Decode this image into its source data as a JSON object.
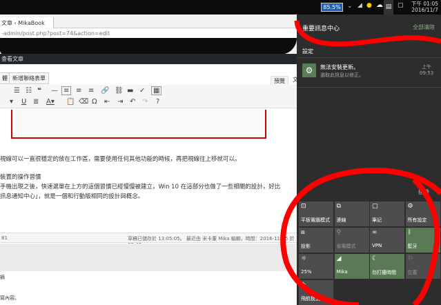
{
  "taskbar": {
    "battery": "85.5%",
    "time": "下午 01:05",
    "date": "2016/11/7",
    "icons": [
      "chevron-up-icon",
      "wifi-icon",
      "warning-shield-icon",
      "cloud-icon",
      "action-center-icon",
      "notes-icon"
    ]
  },
  "browser": {
    "tab_title": "文章 ‹ MikaBook —",
    "url": "-admin/post.php?post=74&action=edit"
  },
  "wp": {
    "admin_bar": "查看文章",
    "add_button_prefix": "體",
    "add_form_button": "新增聯絡表單",
    "tab_preview": "預覽",
    "tab_text": "文"
  },
  "content": {
    "lines": [
      "視線可以一直很穩定的放在工作區，需要使用任何其他功能的時候，再把視線往上移就可以。",
      "裝置的操作習慣",
      "手機出現之後，快速選單在上方的這個習慣已經慢慢被建立，Win 10 在這部分也做了一些相關的設計，好比",
      "訊息通知中心」，就是一個和行動版相同的設計與概念。"
    ],
    "word_count": "81",
    "status": "草稿已儲存於 13:05:05。 最近由 米卡董 Mika 編輯，時間：2016-11-05 於 09:49",
    "section": "摘",
    "excerpt": "寫內容。"
  },
  "action_center": {
    "title": "重要訊息中心",
    "clear_all": "全部清除",
    "group": "設定",
    "notification": {
      "title": "無法安裝更新。",
      "body": "選取此訊息以修正。",
      "time_label": "上午",
      "time": "09:53"
    },
    "collapse": "摺疊",
    "tiles": [
      {
        "label": "平板電腦模式",
        "icon": "tablet-mode-icon",
        "state": "off"
      },
      {
        "label": "連線",
        "icon": "connect-icon",
        "state": "off"
      },
      {
        "label": "筆記",
        "icon": "note-icon",
        "state": "off"
      },
      {
        "label": "所有設定",
        "icon": "settings-icon",
        "state": "off"
      },
      {
        "label": "投影",
        "icon": "project-icon",
        "state": "off"
      },
      {
        "label": "省電模式",
        "icon": "battery-saver-icon",
        "state": "disabled"
      },
      {
        "label": "VPN",
        "icon": "vpn-icon",
        "state": "off"
      },
      {
        "label": "藍牙",
        "icon": "bluetooth-icon",
        "state": "on"
      },
      {
        "label": "25%",
        "icon": "brightness-icon",
        "state": "off"
      },
      {
        "label": "Mika",
        "icon": "wifi-icon",
        "state": "on"
      },
      {
        "label": "勿打擾時間",
        "icon": "moon-icon",
        "state": "on"
      },
      {
        "label": "位置",
        "icon": "location-icon",
        "state": "disabled"
      },
      {
        "label": "飛航模式",
        "icon": "airplane-icon",
        "state": "off"
      }
    ]
  }
}
